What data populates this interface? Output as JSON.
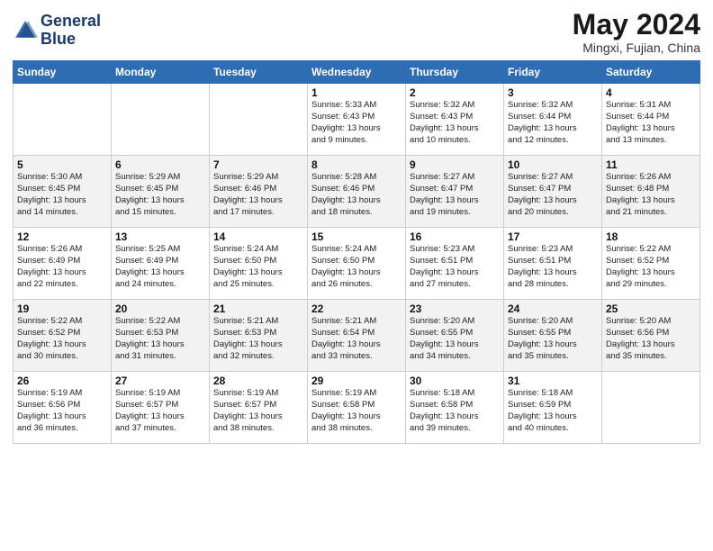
{
  "header": {
    "logo_line1": "General",
    "logo_line2": "Blue",
    "month_year": "May 2024",
    "location": "Mingxi, Fujian, China"
  },
  "weekdays": [
    "Sunday",
    "Monday",
    "Tuesday",
    "Wednesday",
    "Thursday",
    "Friday",
    "Saturday"
  ],
  "weeks": [
    [
      {
        "day": "",
        "info": ""
      },
      {
        "day": "",
        "info": ""
      },
      {
        "day": "",
        "info": ""
      },
      {
        "day": "1",
        "info": "Sunrise: 5:33 AM\nSunset: 6:43 PM\nDaylight: 13 hours\nand 9 minutes."
      },
      {
        "day": "2",
        "info": "Sunrise: 5:32 AM\nSunset: 6:43 PM\nDaylight: 13 hours\nand 10 minutes."
      },
      {
        "day": "3",
        "info": "Sunrise: 5:32 AM\nSunset: 6:44 PM\nDaylight: 13 hours\nand 12 minutes."
      },
      {
        "day": "4",
        "info": "Sunrise: 5:31 AM\nSunset: 6:44 PM\nDaylight: 13 hours\nand 13 minutes."
      }
    ],
    [
      {
        "day": "5",
        "info": "Sunrise: 5:30 AM\nSunset: 6:45 PM\nDaylight: 13 hours\nand 14 minutes."
      },
      {
        "day": "6",
        "info": "Sunrise: 5:29 AM\nSunset: 6:45 PM\nDaylight: 13 hours\nand 15 minutes."
      },
      {
        "day": "7",
        "info": "Sunrise: 5:29 AM\nSunset: 6:46 PM\nDaylight: 13 hours\nand 17 minutes."
      },
      {
        "day": "8",
        "info": "Sunrise: 5:28 AM\nSunset: 6:46 PM\nDaylight: 13 hours\nand 18 minutes."
      },
      {
        "day": "9",
        "info": "Sunrise: 5:27 AM\nSunset: 6:47 PM\nDaylight: 13 hours\nand 19 minutes."
      },
      {
        "day": "10",
        "info": "Sunrise: 5:27 AM\nSunset: 6:47 PM\nDaylight: 13 hours\nand 20 minutes."
      },
      {
        "day": "11",
        "info": "Sunrise: 5:26 AM\nSunset: 6:48 PM\nDaylight: 13 hours\nand 21 minutes."
      }
    ],
    [
      {
        "day": "12",
        "info": "Sunrise: 5:26 AM\nSunset: 6:49 PM\nDaylight: 13 hours\nand 22 minutes."
      },
      {
        "day": "13",
        "info": "Sunrise: 5:25 AM\nSunset: 6:49 PM\nDaylight: 13 hours\nand 24 minutes."
      },
      {
        "day": "14",
        "info": "Sunrise: 5:24 AM\nSunset: 6:50 PM\nDaylight: 13 hours\nand 25 minutes."
      },
      {
        "day": "15",
        "info": "Sunrise: 5:24 AM\nSunset: 6:50 PM\nDaylight: 13 hours\nand 26 minutes."
      },
      {
        "day": "16",
        "info": "Sunrise: 5:23 AM\nSunset: 6:51 PM\nDaylight: 13 hours\nand 27 minutes."
      },
      {
        "day": "17",
        "info": "Sunrise: 5:23 AM\nSunset: 6:51 PM\nDaylight: 13 hours\nand 28 minutes."
      },
      {
        "day": "18",
        "info": "Sunrise: 5:22 AM\nSunset: 6:52 PM\nDaylight: 13 hours\nand 29 minutes."
      }
    ],
    [
      {
        "day": "19",
        "info": "Sunrise: 5:22 AM\nSunset: 6:52 PM\nDaylight: 13 hours\nand 30 minutes."
      },
      {
        "day": "20",
        "info": "Sunrise: 5:22 AM\nSunset: 6:53 PM\nDaylight: 13 hours\nand 31 minutes."
      },
      {
        "day": "21",
        "info": "Sunrise: 5:21 AM\nSunset: 6:53 PM\nDaylight: 13 hours\nand 32 minutes."
      },
      {
        "day": "22",
        "info": "Sunrise: 5:21 AM\nSunset: 6:54 PM\nDaylight: 13 hours\nand 33 minutes."
      },
      {
        "day": "23",
        "info": "Sunrise: 5:20 AM\nSunset: 6:55 PM\nDaylight: 13 hours\nand 34 minutes."
      },
      {
        "day": "24",
        "info": "Sunrise: 5:20 AM\nSunset: 6:55 PM\nDaylight: 13 hours\nand 35 minutes."
      },
      {
        "day": "25",
        "info": "Sunrise: 5:20 AM\nSunset: 6:56 PM\nDaylight: 13 hours\nand 35 minutes."
      }
    ],
    [
      {
        "day": "26",
        "info": "Sunrise: 5:19 AM\nSunset: 6:56 PM\nDaylight: 13 hours\nand 36 minutes."
      },
      {
        "day": "27",
        "info": "Sunrise: 5:19 AM\nSunset: 6:57 PM\nDaylight: 13 hours\nand 37 minutes."
      },
      {
        "day": "28",
        "info": "Sunrise: 5:19 AM\nSunset: 6:57 PM\nDaylight: 13 hours\nand 38 minutes."
      },
      {
        "day": "29",
        "info": "Sunrise: 5:19 AM\nSunset: 6:58 PM\nDaylight: 13 hours\nand 38 minutes."
      },
      {
        "day": "30",
        "info": "Sunrise: 5:18 AM\nSunset: 6:58 PM\nDaylight: 13 hours\nand 39 minutes."
      },
      {
        "day": "31",
        "info": "Sunrise: 5:18 AM\nSunset: 6:59 PM\nDaylight: 13 hours\nand 40 minutes."
      },
      {
        "day": "",
        "info": ""
      }
    ]
  ]
}
